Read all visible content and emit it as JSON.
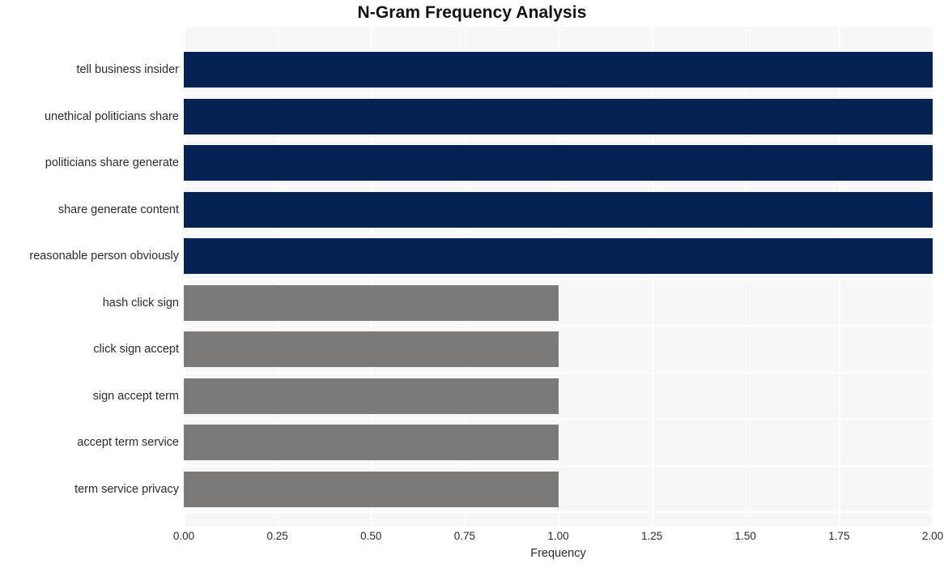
{
  "chart_data": {
    "type": "bar",
    "orientation": "horizontal",
    "title": "N-Gram Frequency Analysis",
    "xlabel": "Frequency",
    "ylabel": "",
    "categories": [
      "tell business insider",
      "unethical politicians share",
      "politicians share generate",
      "share generate content",
      "reasonable person obviously",
      "hash click sign",
      "click sign accept",
      "sign accept term",
      "accept term service",
      "term service privacy"
    ],
    "values": [
      2,
      2,
      2,
      2,
      2,
      1,
      1,
      1,
      1,
      1
    ],
    "bar_colors": [
      "#042253",
      "#042253",
      "#042253",
      "#042253",
      "#042253",
      "#7b7a78",
      "#7b7a78",
      "#7b7a78",
      "#7b7a78",
      "#7b7a78"
    ],
    "xlim": [
      0,
      2
    ],
    "xticks": [
      0,
      0.25,
      0.5,
      0.75,
      1,
      1.25,
      1.5,
      1.75,
      2
    ],
    "xtick_labels": [
      "0.00",
      "0.25",
      "0.50",
      "0.75",
      "1.00",
      "1.25",
      "1.50",
      "1.75",
      "2.00"
    ],
    "grid": true,
    "grid_color": "#ffffff",
    "plot_background": "#f7f7f7",
    "figure_background": "#ffffff",
    "legend": null
  }
}
